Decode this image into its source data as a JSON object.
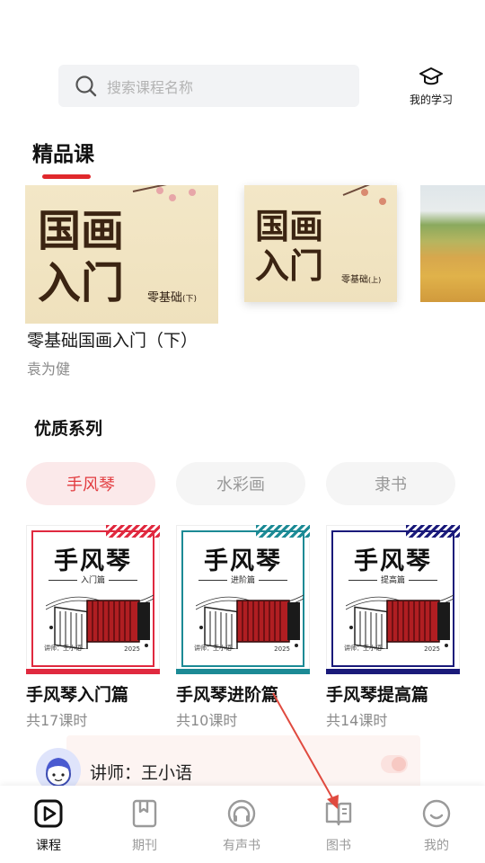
{
  "header": {
    "search_placeholder": "搜索课程名称",
    "my_learning_label": "我的学习"
  },
  "featured": {
    "title": "精品课",
    "cards": [
      {
        "cover_line1": "国画",
        "cover_line2": "入门",
        "cover_tag": "零基础",
        "cover_part": "(下)"
      },
      {
        "cover_line1": "国画",
        "cover_line2": "入门",
        "cover_tag": "零基础",
        "cover_part": "(上)"
      }
    ],
    "course_name": "零基础国画入门（下）",
    "course_teacher": "袁为健"
  },
  "series": {
    "title": "优质系列",
    "chips": [
      {
        "label": "手风琴",
        "active": true
      },
      {
        "label": "水彩画",
        "active": false
      },
      {
        "label": "隶书",
        "active": false
      }
    ],
    "cards": [
      {
        "cover_title": "手风琴",
        "cover_sub": "入门篇",
        "cover_teacher": "讲师：王小语",
        "cover_year": "2025",
        "name": "手风琴入门篇",
        "count": "共17课时",
        "color": "#e0293f"
      },
      {
        "cover_title": "手风琴",
        "cover_sub": "进阶篇",
        "cover_teacher": "讲师：王小语",
        "cover_year": "2025",
        "name": "手风琴进阶篇",
        "count": "共10课时",
        "color": "#1c8a95"
      },
      {
        "cover_title": "手风琴",
        "cover_sub": "提高篇",
        "cover_teacher": "讲师：王小语",
        "cover_year": "2025",
        "name": "手风琴提高篇",
        "count": "共14课时",
        "color": "#1a1a7a"
      }
    ]
  },
  "teacher": {
    "label": "讲师：王小语"
  },
  "tabbar": {
    "tabs": [
      {
        "label": "课程",
        "icon": "play-square-icon",
        "active": true
      },
      {
        "label": "期刊",
        "icon": "bookmark-book-icon",
        "active": false
      },
      {
        "label": "有声书",
        "icon": "headphones-icon",
        "active": false
      },
      {
        "label": "图书",
        "icon": "open-book-icon",
        "active": false
      },
      {
        "label": "我的",
        "icon": "smile-face-icon",
        "active": false
      }
    ]
  },
  "colors": {
    "accent": "#e0282c",
    "annotation_arrow": "#e04a3f"
  }
}
